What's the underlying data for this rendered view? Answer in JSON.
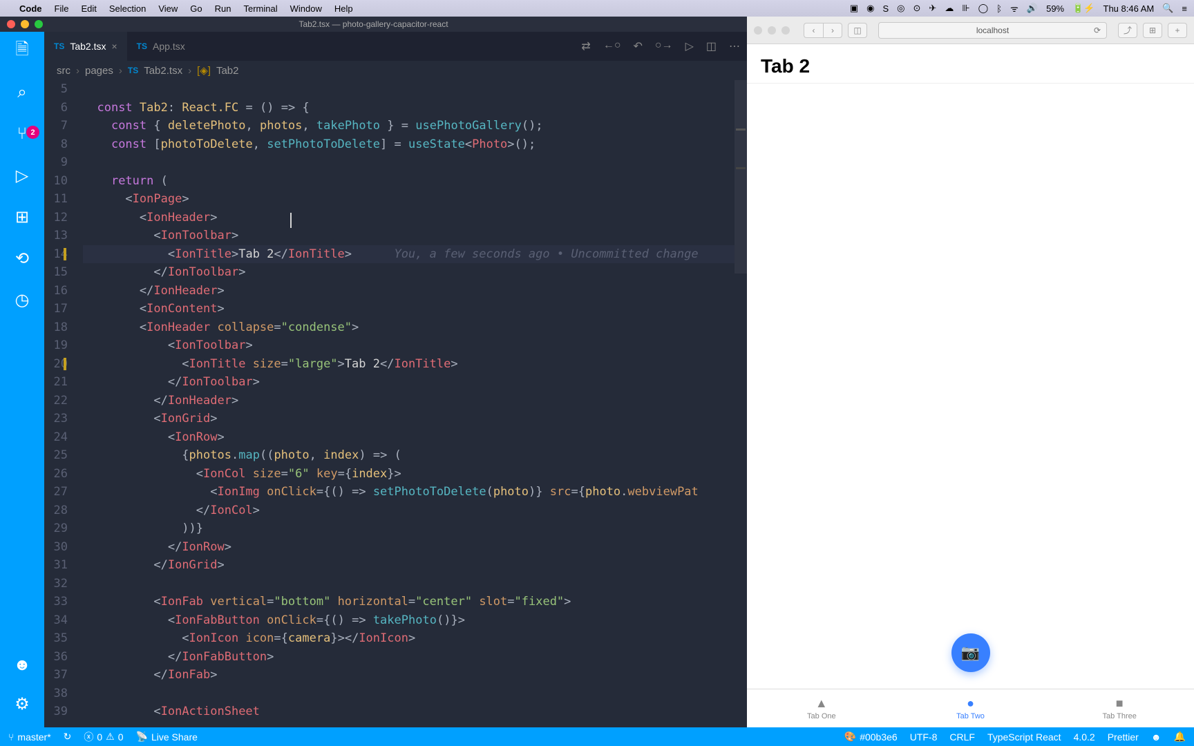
{
  "menubar": {
    "app": "Code",
    "items": [
      "File",
      "Edit",
      "Selection",
      "View",
      "Go",
      "Run",
      "Terminal",
      "Window",
      "Help"
    ],
    "battery": "59%",
    "clock": "Thu 8:46 AM"
  },
  "vscode": {
    "title": "Tab2.tsx — photo-gallery-capacitor-react",
    "tabs": [
      {
        "label": "Tab2.tsx",
        "active": true,
        "dirty": false
      },
      {
        "label": "App.tsx",
        "active": false,
        "dirty": false
      }
    ],
    "scm_badge": "2",
    "breadcrumbs": {
      "parts": [
        "src",
        "pages",
        "Tab2.tsx",
        "Tab2"
      ]
    },
    "code": {
      "first_line_number": 5,
      "modified_lines": [
        14,
        20
      ],
      "current_line": 14,
      "blame": "You, a few seconds ago • Uncommitted change",
      "lines": [
        {
          "n": 5,
          "raw": ""
        },
        {
          "n": 6,
          "raw": "  const Tab2: React.FC = () => {"
        },
        {
          "n": 7,
          "raw": "    const { deletePhoto, photos, takePhoto } = usePhotoGallery();"
        },
        {
          "n": 8,
          "raw": "    const [photoToDelete, setPhotoToDelete] = useState<Photo>();"
        },
        {
          "n": 9,
          "raw": ""
        },
        {
          "n": 10,
          "raw": "    return ("
        },
        {
          "n": 11,
          "raw": "      <IonPage>"
        },
        {
          "n": 12,
          "raw": "        <IonHeader>"
        },
        {
          "n": 13,
          "raw": "          <IonToolbar>"
        },
        {
          "n": 14,
          "raw": "            <IonTitle>Tab 2</IonTitle>"
        },
        {
          "n": 15,
          "raw": "          </IonToolbar>"
        },
        {
          "n": 16,
          "raw": "        </IonHeader>"
        },
        {
          "n": 17,
          "raw": "        <IonContent>"
        },
        {
          "n": 18,
          "raw": "        <IonHeader collapse=\"condense\">"
        },
        {
          "n": 19,
          "raw": "            <IonToolbar>"
        },
        {
          "n": 20,
          "raw": "              <IonTitle size=\"large\">Tab 2</IonTitle>"
        },
        {
          "n": 21,
          "raw": "            </IonToolbar>"
        },
        {
          "n": 22,
          "raw": "          </IonHeader>"
        },
        {
          "n": 23,
          "raw": "          <IonGrid>"
        },
        {
          "n": 24,
          "raw": "            <IonRow>"
        },
        {
          "n": 25,
          "raw": "              {photos.map((photo, index) => ("
        },
        {
          "n": 26,
          "raw": "                <IonCol size=\"6\" key={index}>"
        },
        {
          "n": 27,
          "raw": "                  <IonImg onClick={() => setPhotoToDelete(photo)} src={photo.webviewPat"
        },
        {
          "n": 28,
          "raw": "                </IonCol>"
        },
        {
          "n": 29,
          "raw": "              ))}"
        },
        {
          "n": 30,
          "raw": "            </IonRow>"
        },
        {
          "n": 31,
          "raw": "          </IonGrid>"
        },
        {
          "n": 32,
          "raw": ""
        },
        {
          "n": 33,
          "raw": "          <IonFab vertical=\"bottom\" horizontal=\"center\" slot=\"fixed\">"
        },
        {
          "n": 34,
          "raw": "            <IonFabButton onClick={() => takePhoto()}>"
        },
        {
          "n": 35,
          "raw": "              <IonIcon icon={camera}></IonIcon>"
        },
        {
          "n": 36,
          "raw": "            </IonFabButton>"
        },
        {
          "n": 37,
          "raw": "          </IonFab>"
        },
        {
          "n": 38,
          "raw": ""
        },
        {
          "n": 39,
          "raw": "          <IonActionSheet"
        }
      ]
    },
    "statusbar": {
      "branch": "master*",
      "sync": "↻",
      "errors": "0",
      "warnings": "0",
      "liveshare": "Live Share",
      "color": "#00b3e6",
      "encoding": "UTF-8",
      "eol": "CRLF",
      "language": "TypeScript React",
      "version": "4.0.2",
      "prettier": "Prettier"
    }
  },
  "safari": {
    "address": "localhost",
    "page": {
      "title": "Tab 2",
      "tabs": [
        {
          "label": "Tab One",
          "shape": "triangle",
          "active": false
        },
        {
          "label": "Tab Two",
          "shape": "ellipse",
          "active": true
        },
        {
          "label": "Tab Three",
          "shape": "square",
          "active": false
        }
      ]
    }
  }
}
